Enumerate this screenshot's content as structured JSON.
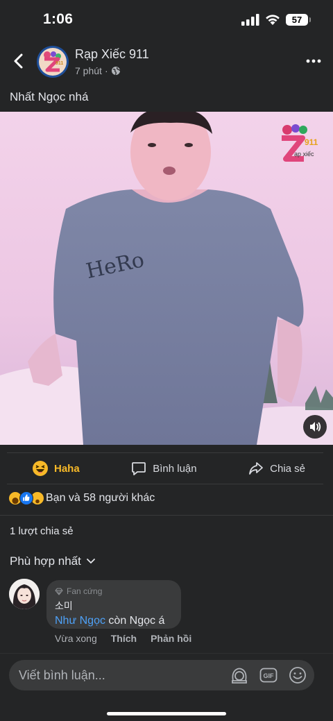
{
  "status_bar": {
    "time": "1:06",
    "battery": "57"
  },
  "post": {
    "page_name": "Rạp Xiếc 911",
    "time": "7 phút",
    "separator": "·",
    "caption": "Nhất Ngọc nhá",
    "avatar_text": "911",
    "watermark": {
      "number": "911",
      "subtitle": "ạp xiếc"
    },
    "shirt_print": "HeRo"
  },
  "actions": {
    "haha": "Haha",
    "comment": "Bình luận",
    "share": "Chia sẻ"
  },
  "reactions": {
    "summary": "Bạn và 58 người khác"
  },
  "shares": "1 lượt chia sẻ",
  "sort": "Phù hợp nhất",
  "comment": {
    "badge": "Fan cứng",
    "author": "소미",
    "mention": "Như Ngọc",
    "text": " còn Ngọc á",
    "time": "Vừa xong",
    "like": "Thích",
    "reply": "Phản hồi"
  },
  "composer": {
    "placeholder": "Viết bình luận..."
  },
  "colors": {
    "haha": "#f7b928",
    "mention": "#4ea1f7",
    "background": "#242526",
    "bubble": "#3a3b3c"
  }
}
